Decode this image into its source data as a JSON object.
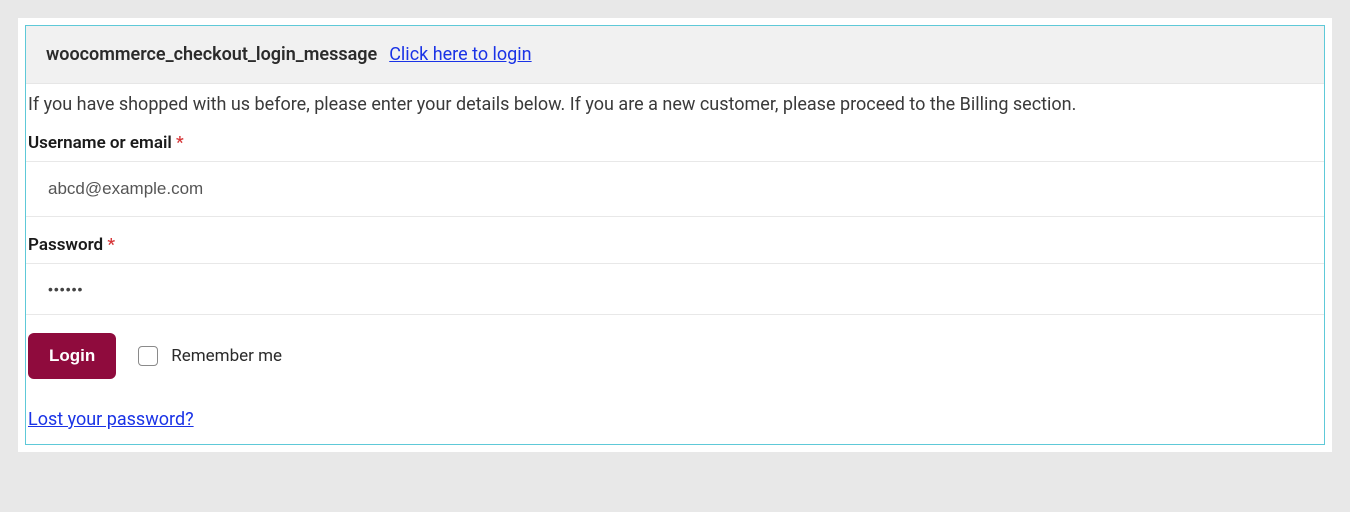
{
  "message": {
    "hook": "woocommerce_checkout_login_message",
    "link_text": "Click here to login"
  },
  "form": {
    "instruction": "If you have shopped with us before, please enter your details below. If you are a new customer, please proceed to the Billing section.",
    "username": {
      "label": "Username or email",
      "required_mark": "*",
      "value": "abcd@example.com"
    },
    "password": {
      "label": "Password",
      "required_mark": "*",
      "value": "••••••"
    },
    "login_button": "Login",
    "remember_label": "Remember me",
    "lost_password": "Lost your password?"
  }
}
